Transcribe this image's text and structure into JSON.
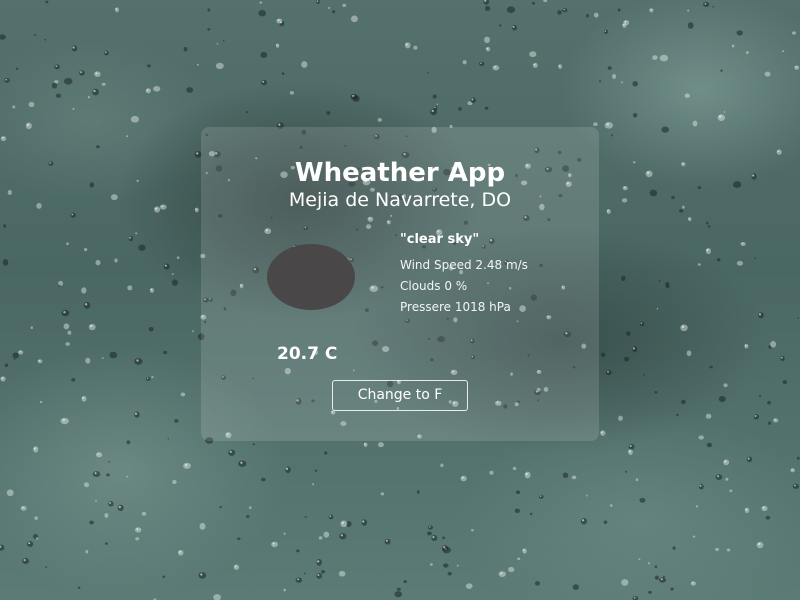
{
  "app": {
    "title": "Wheather App",
    "location": "Mejia de Navarrete, DO"
  },
  "weather": {
    "description": "\"clear sky\"",
    "wind_speed": "Wind Speed 2.48 m/s",
    "clouds": "Clouds 0 %",
    "pressure": "Pressere 1018 hPa",
    "temperature": "20.7 C",
    "icon": "weather-condition-icon"
  },
  "controls": {
    "toggle_unit_label": "Change to F"
  },
  "colors": {
    "background": "#4d6a66",
    "card_overlay": "rgba(255,255,255,0.13)",
    "text": "#ffffff",
    "icon_placeholder": "#4a4748"
  }
}
